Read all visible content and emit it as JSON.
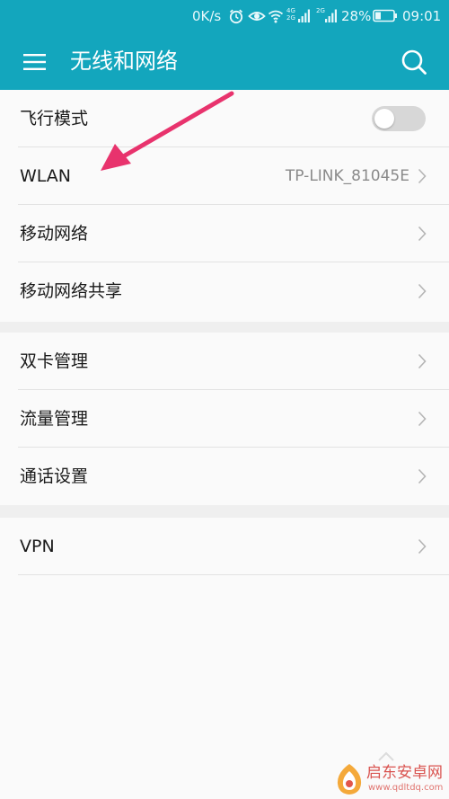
{
  "status_bar": {
    "net_speed": "0K/s",
    "sim1_tags": [
      "4G",
      "2G"
    ],
    "sim2_tag": "2G",
    "battery": "28%",
    "time": "09:01",
    "icons": [
      "alarm-icon",
      "eye-icon",
      "wifi-icon",
      "signal-icon",
      "battery-icon"
    ]
  },
  "app_bar": {
    "title": "无线和网络",
    "menu_icon": "hamburger-menu-icon",
    "search_icon": "search-icon",
    "background": "#13a6bd"
  },
  "sections": [
    {
      "rows": [
        {
          "label": "飞行模式",
          "control": "toggle",
          "toggle_on": false
        },
        {
          "label": "WLAN",
          "value": "TP-LINK_81045E",
          "control": "chevron"
        },
        {
          "label": "移动网络",
          "control": "chevron"
        },
        {
          "label": "移动网络共享",
          "control": "chevron"
        }
      ]
    },
    {
      "rows": [
        {
          "label": "双卡管理",
          "control": "chevron"
        },
        {
          "label": "流量管理",
          "control": "chevron"
        },
        {
          "label": "通话设置",
          "control": "chevron"
        }
      ]
    },
    {
      "rows": [
        {
          "label": "VPN",
          "control": "chevron"
        }
      ]
    }
  ],
  "annotation": {
    "arrow_color": "#e8336d",
    "points_to": "WLAN"
  },
  "watermark": {
    "name": "启东安卓网",
    "url": "www.qdltdq.com"
  }
}
